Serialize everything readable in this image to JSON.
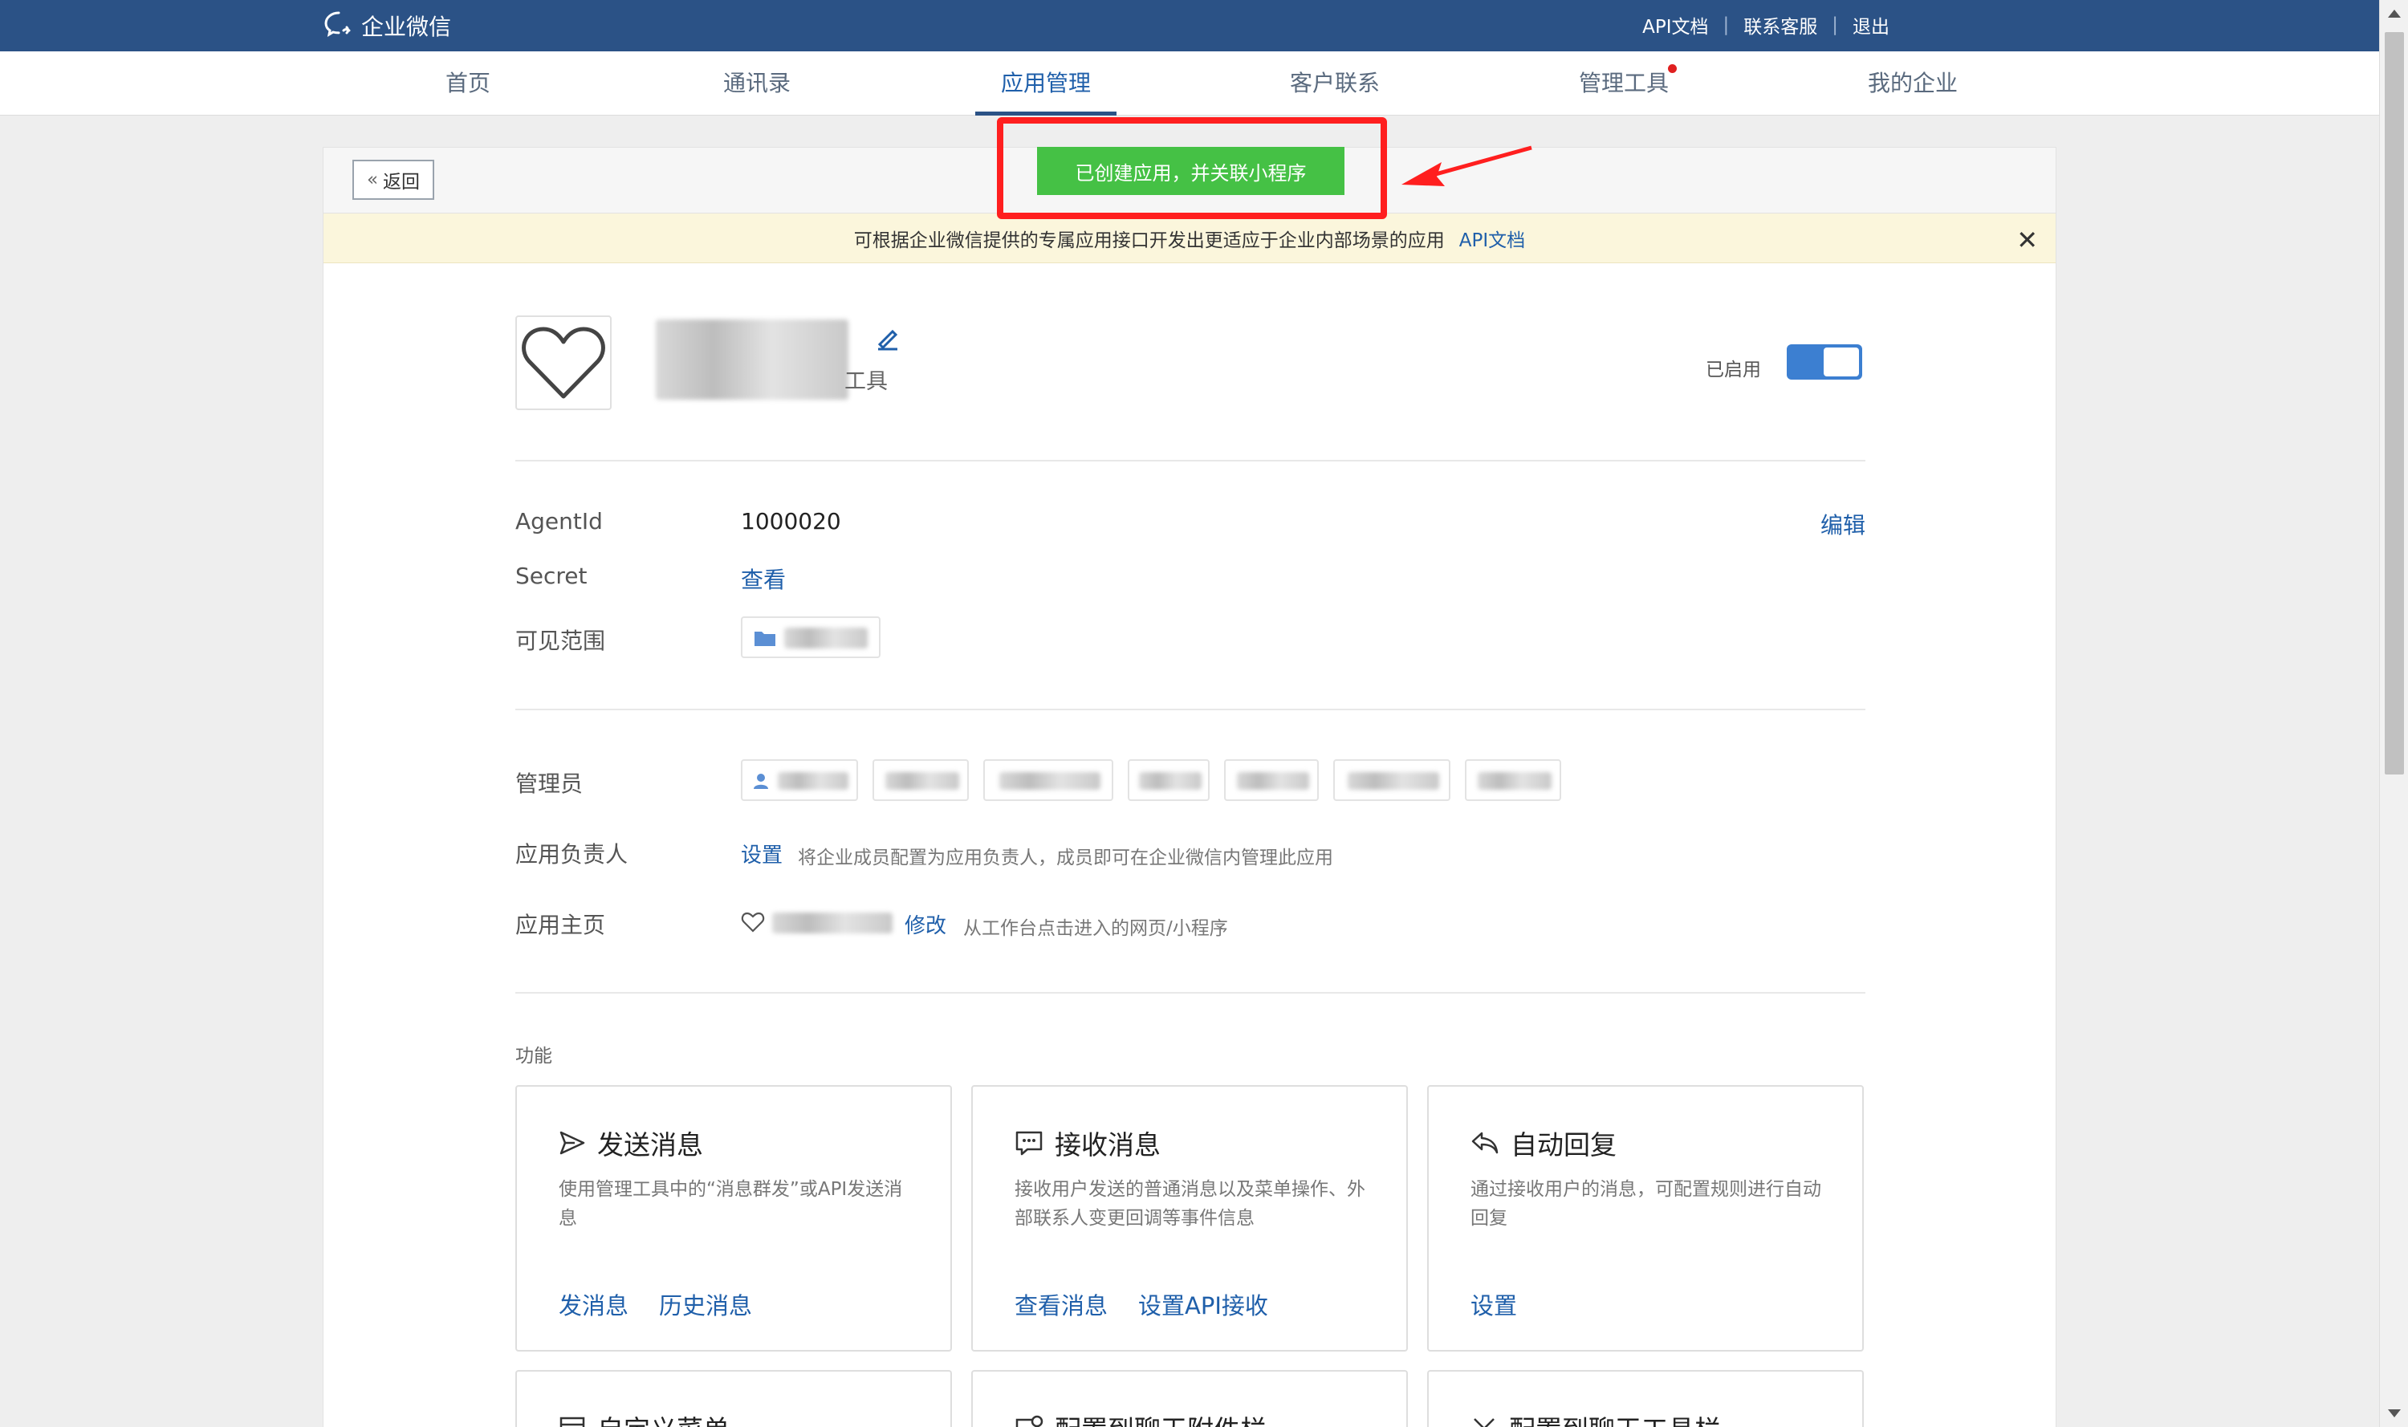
{
  "topbar": {
    "logo_text": "企业微信",
    "links": [
      "API文档",
      "联系客服",
      "退出"
    ]
  },
  "nav": {
    "items": [
      "首页",
      "通讯录",
      "应用管理",
      "客户联系",
      "管理工具",
      "我的企业"
    ],
    "active": "应用管理",
    "notify_dot_on": "管理工具"
  },
  "header": {
    "back_label": "返回",
    "created_button": "已创建应用，并关联小程序"
  },
  "notice": {
    "text": "可根据企业微信提供的专属应用接口开发出更适应于企业内部场景的应用",
    "link": "API文档",
    "close": "✕"
  },
  "app": {
    "name_visible_tail": "",
    "sub_visible_tail": "工具",
    "status_label": "已启用",
    "enabled": true
  },
  "details": {
    "agentid_label": "AgentId",
    "agentid_value": "1000020",
    "edit_label": "编辑",
    "secret_label": "Secret",
    "secret_link": "查看",
    "scope_label": "可见范围"
  },
  "admins": {
    "admin_label": "管理员",
    "owner_label": "应用负责人",
    "owner_link": "设置",
    "owner_hint": "将企业成员配置为应用负责人，成员即可在企业微信内管理此应用",
    "home_label": "应用主页",
    "home_link": "修改",
    "home_hint": "从工作台点击进入的网页/小程序"
  },
  "features": {
    "section_title": "功能",
    "cards": [
      {
        "icon": "send-icon",
        "title": "发送消息",
        "desc": "使用管理工具中的“消息群发”或API发送消息",
        "links": [
          "发消息",
          "历史消息"
        ]
      },
      {
        "icon": "chat-icon",
        "title": "接收消息",
        "desc": "接收用户发送的普通消息以及菜单操作、外部联系人变更回调等事件信息",
        "links": [
          "查看消息",
          "设置API接收"
        ]
      },
      {
        "icon": "reply-icon",
        "title": "自动回复",
        "desc": "通过接收用户的消息，可配置规则进行自动回复",
        "links": [
          "设置"
        ]
      }
    ],
    "next_row": [
      "自定义菜单",
      "配置到聊天附件栏",
      "配置到聊天工具栏"
    ]
  },
  "colors": {
    "topbar": "#2b5286",
    "link": "#1f5faa",
    "green_button": "#45c145",
    "highlight_red": "#ff1f1f",
    "toggle_on": "#3c7fd1"
  }
}
